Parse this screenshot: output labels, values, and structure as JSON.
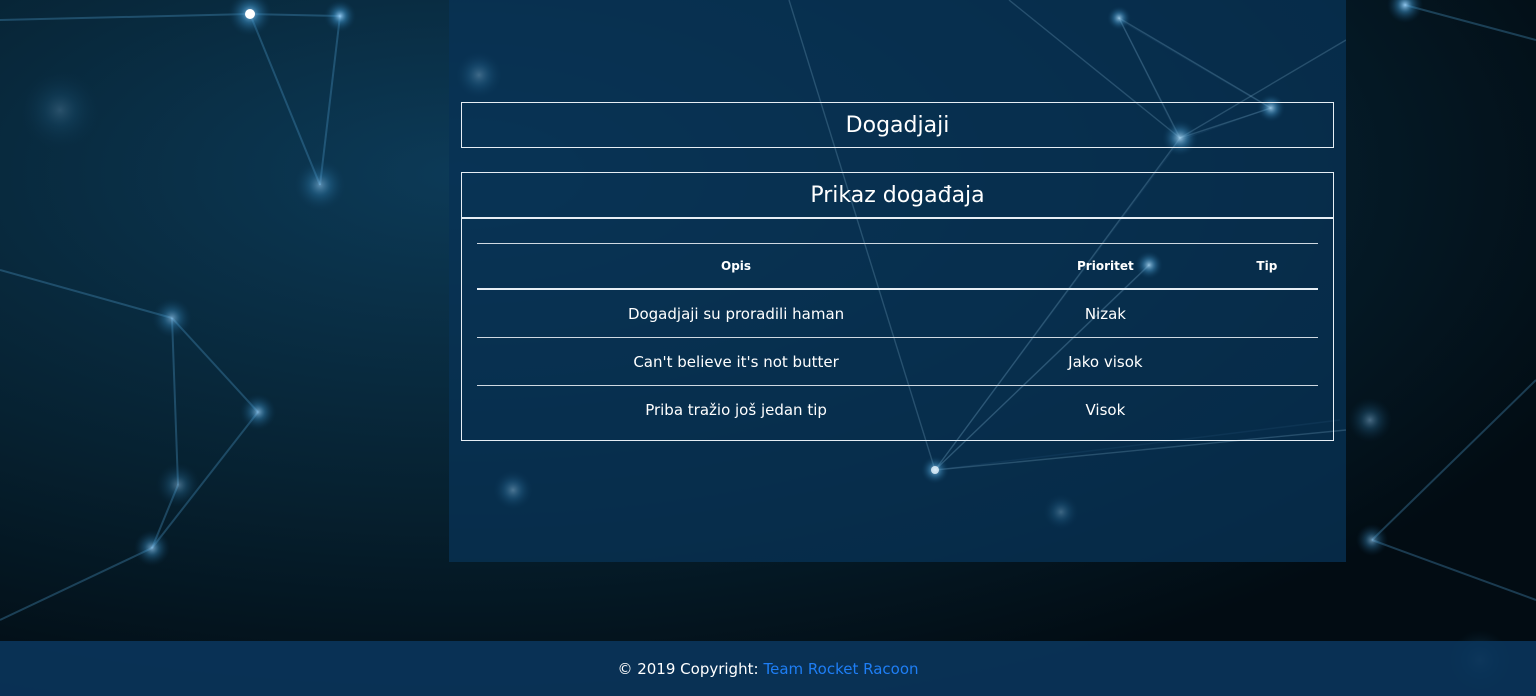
{
  "page": {
    "title_box": "Dogadjaji",
    "card_title": "Prikaz događaja"
  },
  "table": {
    "headers": [
      "Opis",
      "Prioritet",
      "Tip"
    ],
    "rows": [
      {
        "opis": "Dogadjaji su proradili haman",
        "prioritet": "Nizak",
        "tip": ""
      },
      {
        "opis": "Can't believe it's not butter",
        "prioritet": "Jako visok",
        "tip": ""
      },
      {
        "opis": "Priba tražio još jedan tip",
        "prioritet": "Visok",
        "tip": ""
      }
    ]
  },
  "footer": {
    "copyright": "© 2019 Copyright:",
    "link_label": "Team Rocket Racoon"
  },
  "colors": {
    "panel": "#083255",
    "footer": "#0a345a",
    "link": "#1e7ef5",
    "text": "#ffffff"
  }
}
